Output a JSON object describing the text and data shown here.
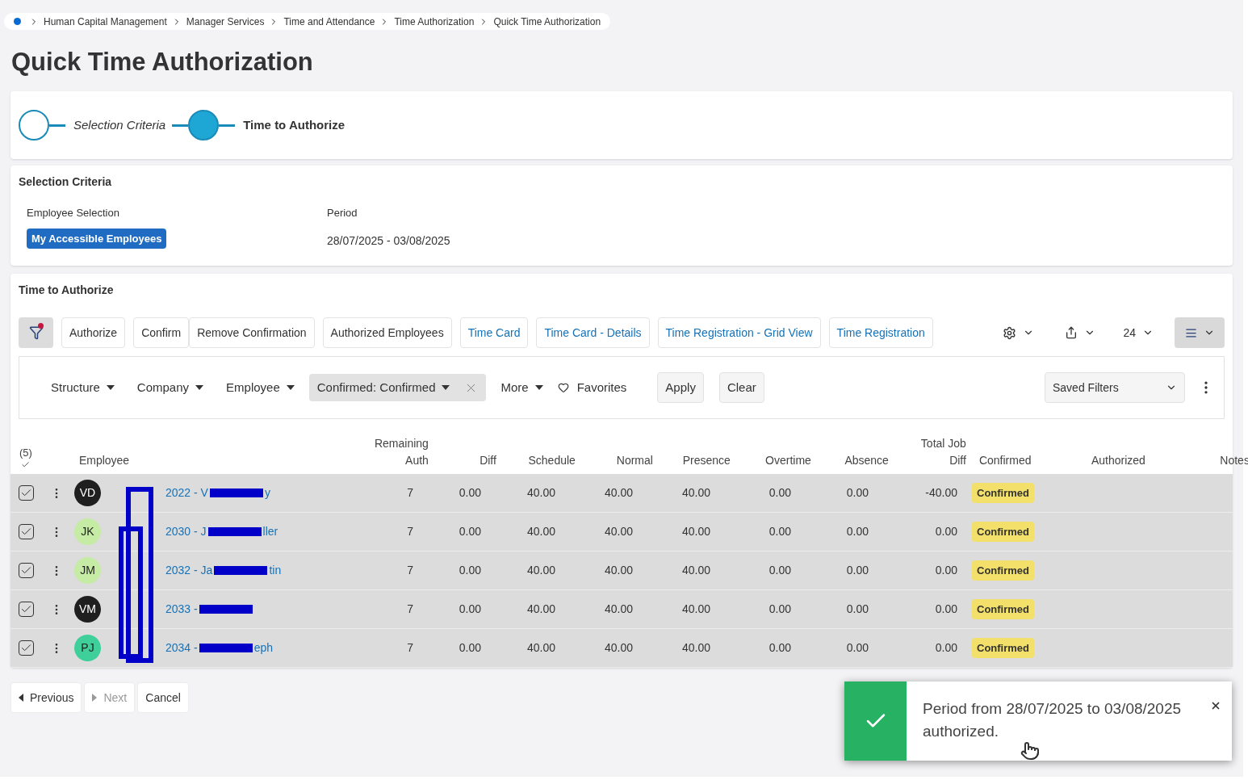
{
  "breadcrumb": [
    "Human Capital Management",
    "Manager Services",
    "Time and Attendance",
    "Time Authorization",
    "Quick Time Authorization"
  ],
  "title": "Quick Time Authorization",
  "steps": [
    {
      "label": "Selection Criteria",
      "selected": false
    },
    {
      "label": "Time to Authorize",
      "selected": true
    }
  ],
  "selection_criteria": {
    "heading": "Selection Criteria",
    "employee_selection_label": "Employee Selection",
    "employee_selection_value": "My Accessible Employees",
    "period_label": "Period",
    "period_value": "28/07/2025 - 03/08/2025"
  },
  "time_to_authorize": {
    "heading": "Time to Authorize",
    "actions": [
      {
        "label": "Authorize",
        "kind": "plain"
      },
      {
        "label": "Confirm",
        "kind": "plain"
      },
      {
        "label": "Remove Confirmation",
        "kind": "plain"
      },
      {
        "label": "Authorized Employees",
        "kind": "plain"
      },
      {
        "label": "Time Card",
        "kind": "link"
      },
      {
        "label": "Time Card - Details",
        "kind": "link"
      },
      {
        "label": "Time Registration - Grid View",
        "kind": "link"
      },
      {
        "label": "Time Registration",
        "kind": "link"
      }
    ],
    "page_size": "24",
    "filters": [
      {
        "label": "Structure",
        "selected": false
      },
      {
        "label": "Company",
        "selected": false
      },
      {
        "label": "Employee",
        "selected": false
      },
      {
        "label": "Confirmed: Confirmed",
        "selected": true
      },
      {
        "label": "More",
        "selected": false
      }
    ],
    "favorites": "Favorites",
    "apply": "Apply",
    "clear": "Clear",
    "saved_filters": "Saved Filters",
    "selected_count": "(5)",
    "columns": [
      "Employee",
      "Remaining Auth",
      "Diff",
      "Schedule",
      "Normal",
      "Presence",
      "Overtime",
      "Absence",
      "Total Job Diff",
      "Confirmed",
      "Authorized",
      "Notes"
    ],
    "rows": [
      {
        "checked": true,
        "initials": "VD",
        "color": "#1f1f1f",
        "name_start": "2022 - V",
        "name_end": "y",
        "remaining": "7",
        "diff": "0.00",
        "schedule": "40.00",
        "normal": "40.00",
        "presence": "40.00",
        "overtime": "0.00",
        "absence": "0.00",
        "total_job_diff": "-40.00",
        "confirmed": "Confirmed"
      },
      {
        "checked": true,
        "initials": "JK",
        "color": "#c5eba5",
        "name_start": "2030 - J",
        "name_end": "ller",
        "remaining": "7",
        "diff": "0.00",
        "schedule": "40.00",
        "normal": "40.00",
        "presence": "40.00",
        "overtime": "0.00",
        "absence": "0.00",
        "total_job_diff": "0.00",
        "confirmed": "Confirmed"
      },
      {
        "checked": true,
        "initials": "JM",
        "color": "#c5eba5",
        "name_start": "2032 - Ja",
        "name_end": "tin",
        "remaining": "7",
        "diff": "0.00",
        "schedule": "40.00",
        "normal": "40.00",
        "presence": "40.00",
        "overtime": "0.00",
        "absence": "0.00",
        "total_job_diff": "0.00",
        "confirmed": "Confirmed"
      },
      {
        "checked": true,
        "initials": "VM",
        "color": "#1f1f1f",
        "name_start": "2033 -",
        "name_end": "",
        "remaining": "7",
        "diff": "0.00",
        "schedule": "40.00",
        "normal": "40.00",
        "presence": "40.00",
        "overtime": "0.00",
        "absence": "0.00",
        "total_job_diff": "0.00",
        "confirmed": "Confirmed"
      },
      {
        "checked": true,
        "initials": "PJ",
        "color": "#3ecf9a",
        "name_start": "2034 -",
        "name_end": "eph",
        "remaining": "7",
        "diff": "0.00",
        "schedule": "40.00",
        "normal": "40.00",
        "presence": "40.00",
        "overtime": "0.00",
        "absence": "0.00",
        "total_job_diff": "0.00",
        "confirmed": "Confirmed"
      }
    ]
  },
  "footer": [
    {
      "label": "Previous",
      "disabled": false
    },
    {
      "label": "Next",
      "disabled": true
    },
    {
      "label": "Cancel",
      "disabled": false
    }
  ],
  "toast": {
    "message": "Period from 28/07/2025 to 03/08/2025 authorized."
  }
}
